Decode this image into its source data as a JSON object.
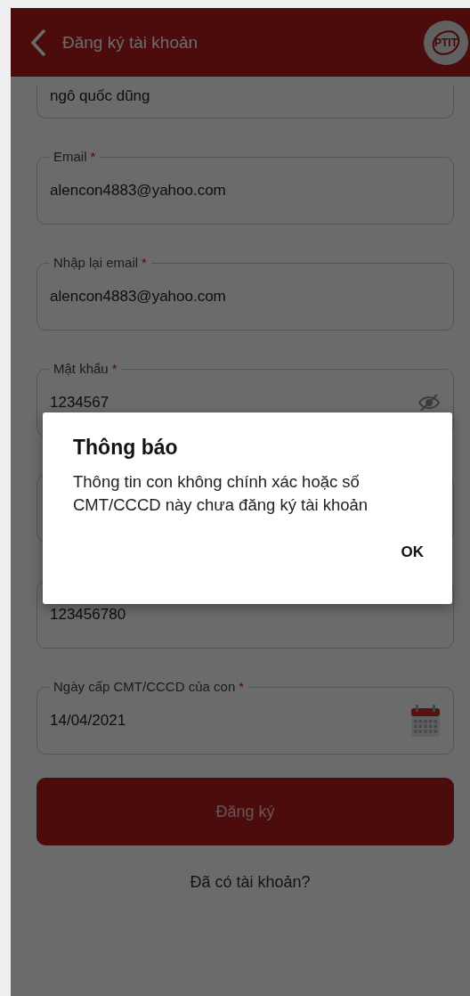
{
  "header": {
    "title": "Đăng ký tài khoản",
    "logo_text": "PTIT"
  },
  "fields": [
    {
      "kind": "text",
      "value": "ngô quốc dũng",
      "cut": true
    },
    {
      "kind": "text",
      "label": "Email",
      "mark": "*",
      "value": "alencon4883@yahoo.com"
    },
    {
      "kind": "text",
      "label": "Nhập lại email",
      "mark": "*",
      "value": "alencon4883@yahoo.com"
    },
    {
      "kind": "password",
      "label": "Mật khẩu",
      "mark": "*",
      "value": "1234567"
    },
    {
      "kind": "text"
    },
    {
      "kind": "text",
      "value": "123456780"
    },
    {
      "kind": "date",
      "label": "Ngày cấp CMT/CCCD của con",
      "mark": "*",
      "value": "14/04/2021"
    }
  ],
  "submit": "Đăng ký",
  "login_link": "Đã có tài khoản?",
  "dialog": {
    "title": "Thông báo",
    "message": "Thông tin con không chính xác hoặc số CMT/CCCD này chưa đăng ký tài khoản",
    "button": "OK"
  }
}
